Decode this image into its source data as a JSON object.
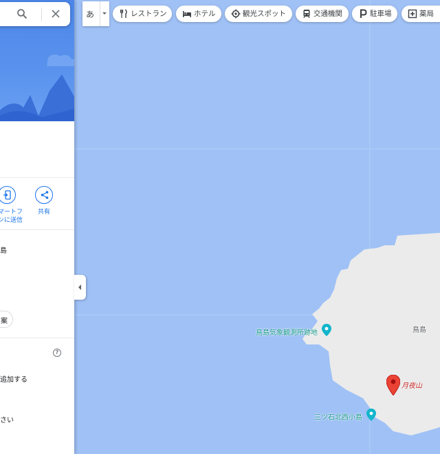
{
  "search": {
    "search_icon": "search-icon",
    "close_icon": "close-icon"
  },
  "language_button": {
    "label": "あ"
  },
  "chips": [
    {
      "label": "レストラン",
      "icon": "restaurant-icon"
    },
    {
      "label": "ホテル",
      "icon": "hotel-icon"
    },
    {
      "label": "観光スポット",
      "icon": "attraction-icon"
    },
    {
      "label": "交通機関",
      "icon": "transit-icon"
    },
    {
      "label": "駐車場",
      "icon": "parking-icon"
    },
    {
      "label": "薬局",
      "icon": "pharmacy-icon"
    }
  ],
  "panel": {
    "actions": [
      {
        "label_line1": "マートフ",
        "label_line2": "ンに送信",
        "icon": "send-to-phone-icon"
      },
      {
        "label_line1": "共有",
        "icon": "share-icon"
      }
    ],
    "address_text": "島",
    "chip_label": "案",
    "add_text": "追加する",
    "bottom_text": "さい"
  },
  "map": {
    "labels": {
      "weather_station": "鳥島気象観測所跡地",
      "island": "鳥島",
      "mountain": "月夜山",
      "islet": "三ツ石北西小島"
    }
  },
  "colors": {
    "water": "#9fc1f6",
    "land": "#ebebeb",
    "accent": "#1a73e8",
    "poi": "#12b5cb",
    "pin": "#ea4335"
  }
}
